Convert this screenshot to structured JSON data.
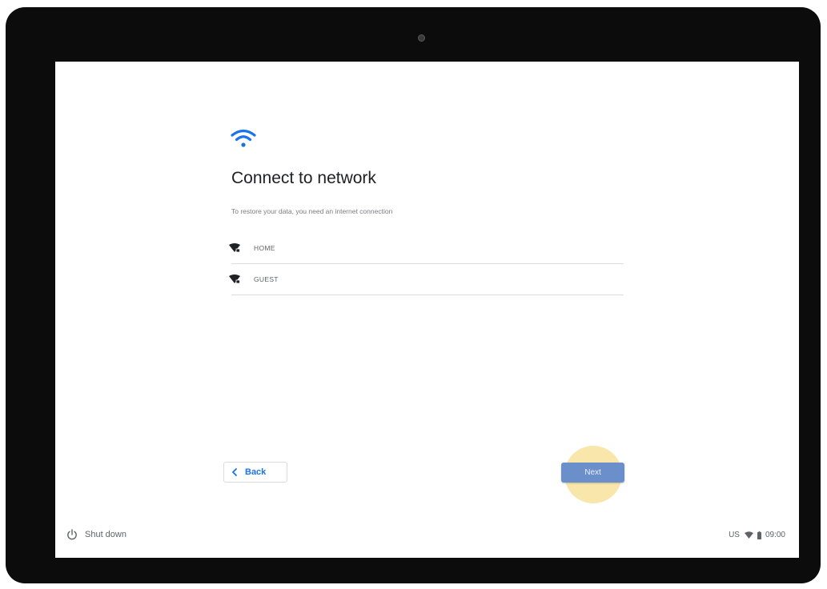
{
  "setup": {
    "title": "Connect to network",
    "subtitle": "To restore your data, you need an internet connection"
  },
  "networks": [
    {
      "name": "HOME",
      "icon": "wifi-secure-icon"
    },
    {
      "name": "GUEST",
      "icon": "wifi-secure-icon"
    }
  ],
  "buttons": {
    "back_label": "Back",
    "next_label": "Next"
  },
  "shelf": {
    "shutdown_label": "Shut down",
    "input_method": "US",
    "time": "09:00"
  },
  "colors": {
    "accent": "#1a73e8",
    "next_button": "#6b8fcb",
    "highlight": "#f7e3a1"
  }
}
